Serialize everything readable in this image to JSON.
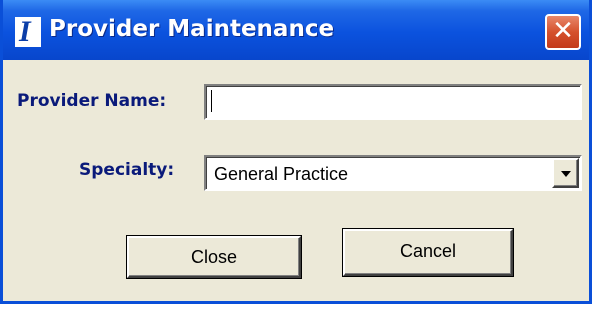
{
  "window": {
    "title": "Provider Maintenance",
    "app_icon_glyph": "I",
    "close_glyph": "✕",
    "titlebar_color": "#0b52de",
    "close_button_color": "#d5512d"
  },
  "form": {
    "provider_name_label": "Provider Name:",
    "provider_name_value": "",
    "specialty_label": "Specialty:",
    "specialty_value": "General Practice",
    "label_color": "#0a1a7a"
  },
  "buttons": {
    "close_label": "Close",
    "cancel_label": "Cancel"
  },
  "icons": {
    "app": "app-logo-icon",
    "close": "close-icon",
    "dropdown": "chevron-down-icon"
  }
}
